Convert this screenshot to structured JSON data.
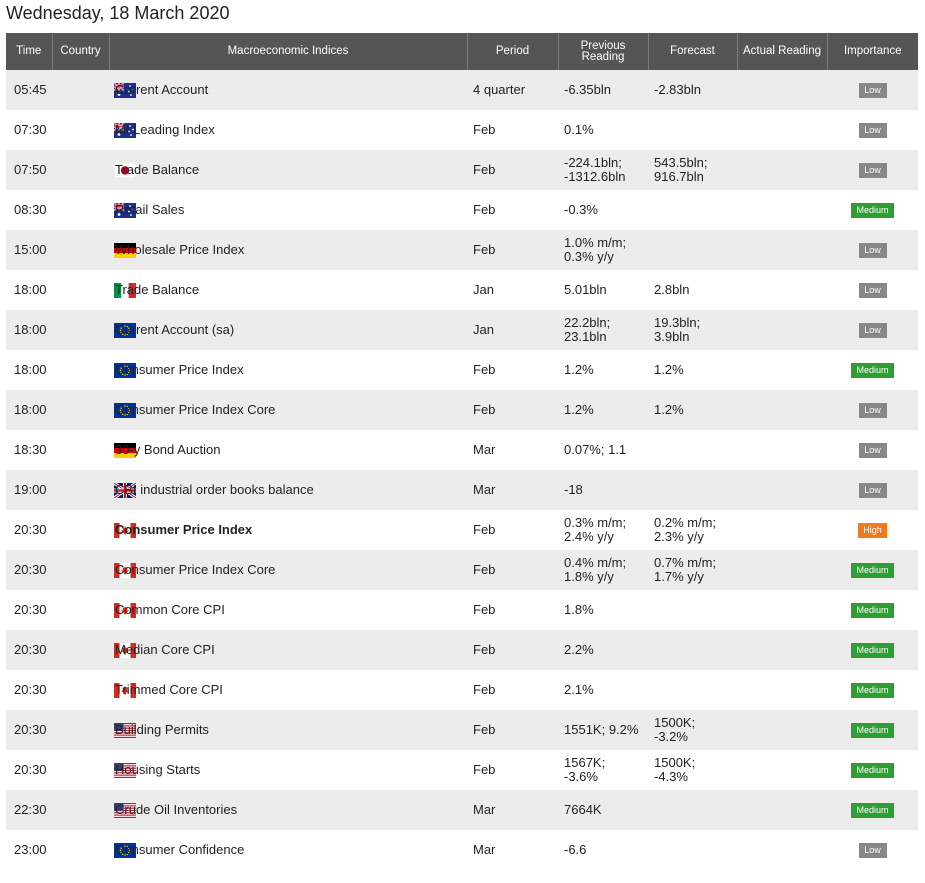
{
  "title": "Wednesday, 18 March 2020",
  "headers": {
    "time": "Time",
    "country": "Country",
    "index": "Macroeconomic Indices",
    "period": "Period",
    "previous_line1": "Previous",
    "previous_line2": "Reading",
    "forecast": "Forecast",
    "actual": "Actual Reading",
    "importance": "Importance"
  },
  "importance_labels": {
    "low": "Low",
    "medium": "Medium",
    "high": "High"
  },
  "colors": {
    "low": "#888888",
    "medium": "#2e9e35",
    "high": "#f07a1e",
    "header_bg": "#555555"
  },
  "rows": [
    {
      "time": "05:45",
      "country": "au-flag-icon",
      "index": "Current Account",
      "bold": false,
      "period": "4 quarter",
      "prev": [
        "-6.35bln"
      ],
      "forecast": [
        "-2.83bln"
      ],
      "actual": "",
      "importance": "low"
    },
    {
      "time": "07:30",
      "country": "au-flag-icon",
      "index": "MI Leading Index",
      "bold": false,
      "period": "Feb",
      "prev": [
        "0.1%"
      ],
      "forecast": [],
      "actual": "",
      "importance": "low"
    },
    {
      "time": "07:50",
      "country": "jp-flag-icon",
      "index": "Trade Balance",
      "bold": false,
      "period": "Feb",
      "prev": [
        "-224.1bln;",
        "-1312.6bln"
      ],
      "forecast": [
        "543.5bln;",
        "916.7bln"
      ],
      "actual": "",
      "importance": "low"
    },
    {
      "time": "08:30",
      "country": "au-flag-icon",
      "index": "Retail Sales",
      "bold": false,
      "period": "Feb",
      "prev": [
        "-0.3%"
      ],
      "forecast": [],
      "actual": "",
      "importance": "medium"
    },
    {
      "time": "15:00",
      "country": "de-flag-icon",
      "index": "Wholesale Price Index",
      "bold": false,
      "period": "Feb",
      "prev": [
        "1.0% m/m;",
        "0.3% y/y"
      ],
      "forecast": [],
      "actual": "",
      "importance": "low"
    },
    {
      "time": "18:00",
      "country": "it-flag-icon",
      "index": "Trade Balance",
      "bold": false,
      "period": "Jan",
      "prev": [
        "5.01bln"
      ],
      "forecast": [
        "2.8bln"
      ],
      "actual": "",
      "importance": "low"
    },
    {
      "time": "18:00",
      "country": "eu-flag-icon",
      "index": "Current Account (sa)",
      "bold": false,
      "period": "Jan",
      "prev": [
        "22.2bln;",
        "23.1bln"
      ],
      "forecast": [
        "19.3bln;",
        "3.9bln"
      ],
      "actual": "",
      "importance": "low"
    },
    {
      "time": "18:00",
      "country": "eu-flag-icon",
      "index": "Consumer Price Index",
      "bold": false,
      "period": "Feb",
      "prev": [
        "1.2%"
      ],
      "forecast": [
        "1.2%"
      ],
      "actual": "",
      "importance": "medium"
    },
    {
      "time": "18:00",
      "country": "eu-flag-icon",
      "index": "Consumer Price Index Core",
      "bold": false,
      "period": "Feb",
      "prev": [
        "1.2%"
      ],
      "forecast": [
        "1.2%"
      ],
      "actual": "",
      "importance": "low"
    },
    {
      "time": "18:30",
      "country": "de-flag-icon",
      "index": "30-y Bond Auction",
      "bold": false,
      "period": "Mar",
      "prev": [
        "0.07%; 1.1"
      ],
      "forecast": [],
      "actual": "",
      "importance": "low"
    },
    {
      "time": "19:00",
      "country": "gb-flag-icon",
      "index": "CBI industrial order books balance",
      "bold": false,
      "period": "Mar",
      "prev": [
        "-18"
      ],
      "forecast": [],
      "actual": "",
      "importance": "low"
    },
    {
      "time": "20:30",
      "country": "ca-flag-icon",
      "index": "Consumer Price Index",
      "bold": true,
      "period": "Feb",
      "prev": [
        "0.3% m/m;",
        "2.4% y/y"
      ],
      "forecast": [
        "0.2% m/m;",
        "2.3% y/y"
      ],
      "actual": "",
      "importance": "high"
    },
    {
      "time": "20:30",
      "country": "ca-flag-icon",
      "index": "Consumer Price Index Core",
      "bold": false,
      "period": "Feb",
      "prev": [
        "0.4% m/m;",
        "1.8% y/y"
      ],
      "forecast": [
        "0.7% m/m;",
        "1.7% y/y"
      ],
      "actual": "",
      "importance": "medium"
    },
    {
      "time": "20:30",
      "country": "ca-flag-icon",
      "index": "Common Core CPI",
      "bold": false,
      "period": "Feb",
      "prev": [
        "1.8%"
      ],
      "forecast": [],
      "actual": "",
      "importance": "medium"
    },
    {
      "time": "20:30",
      "country": "ca-flag-icon",
      "index": "Median Core CPI",
      "bold": false,
      "period": "Feb",
      "prev": [
        "2.2%"
      ],
      "forecast": [],
      "actual": "",
      "importance": "medium"
    },
    {
      "time": "20:30",
      "country": "ca-flag-icon",
      "index": "Trimmed Core CPI",
      "bold": false,
      "period": "Feb",
      "prev": [
        "2.1%"
      ],
      "forecast": [],
      "actual": "",
      "importance": "medium"
    },
    {
      "time": "20:30",
      "country": "us-flag-icon",
      "index": "Building Permits",
      "bold": false,
      "period": "Feb",
      "prev": [
        "1551K; 9.2%"
      ],
      "forecast": [
        "1500K;",
        "-3.2%"
      ],
      "actual": "",
      "importance": "medium"
    },
    {
      "time": "20:30",
      "country": "us-flag-icon",
      "index": "Housing Starts",
      "bold": false,
      "period": "Feb",
      "prev": [
        "1567K;",
        "-3.6%"
      ],
      "forecast": [
        "1500K;",
        "-4.3%"
      ],
      "actual": "",
      "importance": "medium"
    },
    {
      "time": "22:30",
      "country": "us-flag-icon",
      "index": "Crude Oil Inventories",
      "bold": false,
      "period": "Mar",
      "prev": [
        "7664K"
      ],
      "forecast": [],
      "actual": "",
      "importance": "medium"
    },
    {
      "time": "23:00",
      "country": "eu-flag-icon",
      "index": "Consumer Confidence",
      "bold": false,
      "period": "Mar",
      "prev": [
        "-6.6"
      ],
      "forecast": [],
      "actual": "",
      "importance": "low"
    }
  ]
}
